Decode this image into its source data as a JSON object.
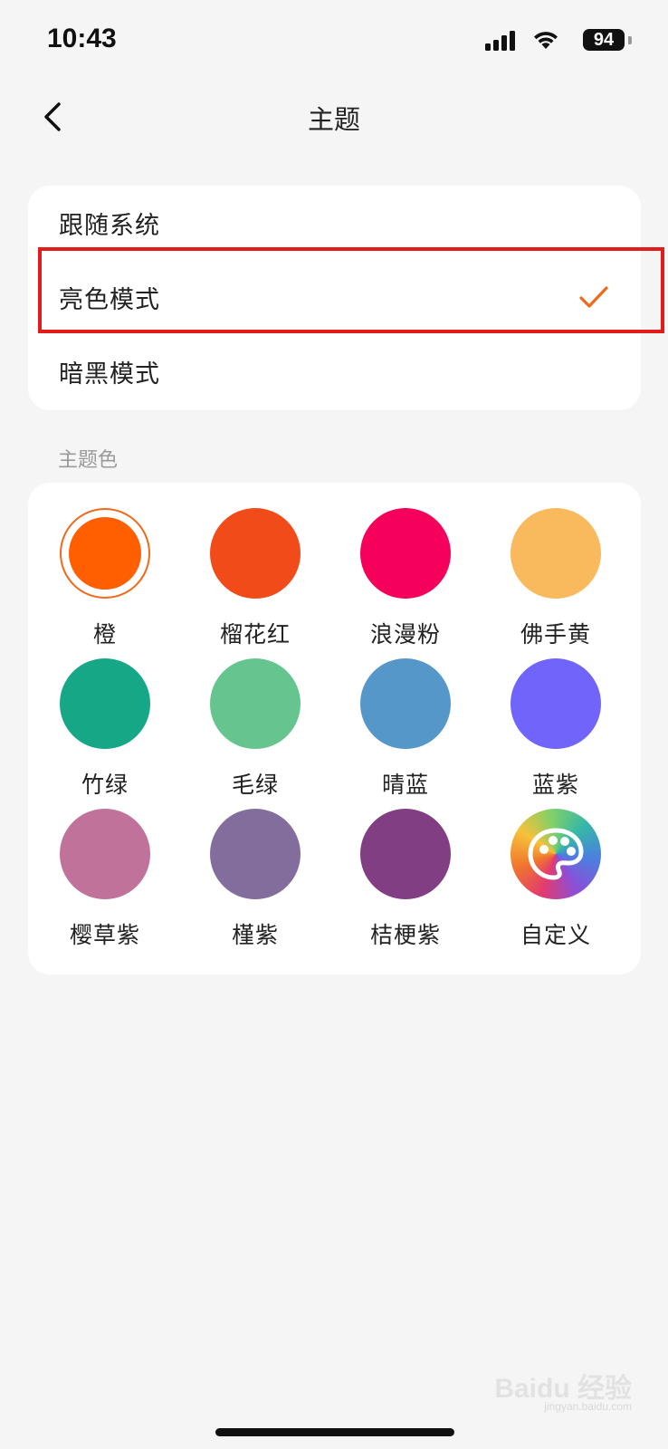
{
  "status_bar": {
    "time": "10:43",
    "battery": "94"
  },
  "nav": {
    "title": "主题",
    "back_icon": "chevron-left-icon"
  },
  "appearance_modes": [
    {
      "label": "跟随系统",
      "selected": false
    },
    {
      "label": "亮色模式",
      "selected": true
    },
    {
      "label": "暗黑模式",
      "selected": false
    }
  ],
  "theme_color_section": {
    "label": "主题色",
    "colors": [
      {
        "name": "橙",
        "color": "#ff5f00",
        "selected": true
      },
      {
        "name": "榴花红",
        "color": "#f24b1a",
        "selected": false
      },
      {
        "name": "浪漫粉",
        "color": "#f5005a",
        "selected": false
      },
      {
        "name": "佛手黄",
        "color": "#f8ba5c",
        "selected": false
      },
      {
        "name": "竹绿",
        "color": "#16a886",
        "selected": false
      },
      {
        "name": "毛绿",
        "color": "#66c58e",
        "selected": false
      },
      {
        "name": "晴蓝",
        "color": "#5597c8",
        "selected": false
      },
      {
        "name": "蓝紫",
        "color": "#7064fb",
        "selected": false
      },
      {
        "name": "樱草紫",
        "color": "#c0729a",
        "selected": false
      },
      {
        "name": "槿紫",
        "color": "#836d9d",
        "selected": false
      },
      {
        "name": "桔梗紫",
        "color": "#823e82",
        "selected": false
      },
      {
        "name": "自定义",
        "color": "gradient",
        "icon": "palette-icon",
        "selected": false
      }
    ]
  },
  "colors": {
    "accent": "#f06a1a",
    "highlight_border": "#e21b1b",
    "background": "#f5f5f5"
  },
  "watermark": {
    "brand": "Baidu 经验",
    "url": "jingyan.baidu.com"
  }
}
